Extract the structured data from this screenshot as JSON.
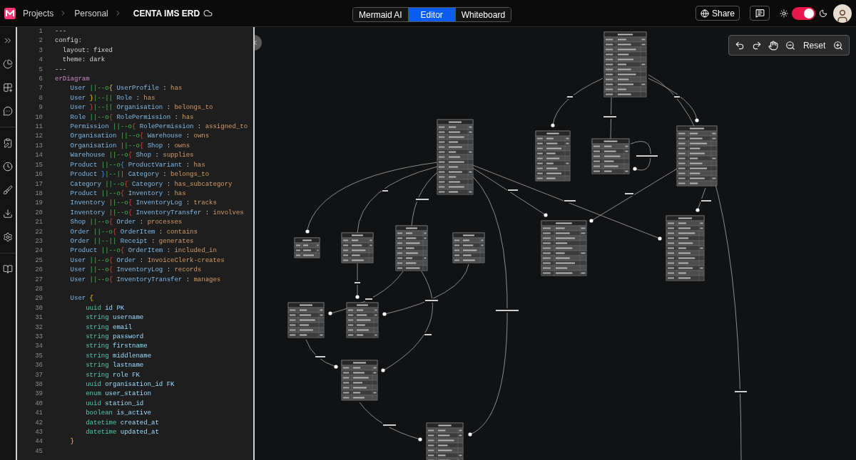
{
  "breadcrumbs": [
    {
      "label": "Projects"
    },
    {
      "label": "Personal"
    }
  ],
  "document_title": "CENTA IMS ERD",
  "tabs": [
    {
      "label": "Mermaid AI",
      "selected": false
    },
    {
      "label": "Editor",
      "selected": true
    },
    {
      "label": "Whiteboard",
      "selected": false
    }
  ],
  "share_button": "Share",
  "theme_toggle": {
    "on": true
  },
  "toolbar": {
    "reset_label": "Reset"
  },
  "editor": {
    "lines": [
      {
        "number": "1",
        "segments": [
          {
            "text": "---",
            "kind": "plain"
          }
        ]
      },
      {
        "number": "2",
        "segments": [
          {
            "text": "config:",
            "kind": "plain"
          }
        ]
      },
      {
        "number": "3",
        "segments": [
          {
            "text": "  layout: fixed",
            "kind": "plain"
          }
        ]
      },
      {
        "number": "4",
        "segments": [
          {
            "text": "  theme: dark",
            "kind": "plain"
          }
        ]
      },
      {
        "number": "5",
        "segments": [
          {
            "text": "---",
            "kind": "plain"
          }
        ]
      },
      {
        "number": "6",
        "segments": [
          {
            "text": "erDiagram",
            "kind": "keyword"
          }
        ]
      },
      {
        "number": "7",
        "segments": [
          {
            "text": "    User ",
            "kind": "entity"
          },
          {
            "text": "||--o",
            "kind": "relation"
          },
          {
            "text": "{",
            "kind": "bracket_gold"
          },
          {
            "text": " UserProfile ",
            "kind": "entity"
          },
          {
            "text": ": ",
            "kind": "punct"
          },
          {
            "text": "has",
            "kind": "label"
          }
        ]
      },
      {
        "number": "8",
        "segments": [
          {
            "text": "    User ",
            "kind": "entity"
          },
          {
            "text": "}",
            "kind": "bracket_gold"
          },
          {
            "text": "|--||",
            "kind": "relation"
          },
          {
            "text": " Role ",
            "kind": "entity"
          },
          {
            "text": ": ",
            "kind": "punct"
          },
          {
            "text": "has",
            "kind": "label"
          }
        ]
      },
      {
        "number": "9",
        "segments": [
          {
            "text": "    User ",
            "kind": "entity"
          },
          {
            "text": "}",
            "kind": "bracket_red"
          },
          {
            "text": "|--||",
            "kind": "relation"
          },
          {
            "text": " Organisation ",
            "kind": "entity"
          },
          {
            "text": ": ",
            "kind": "punct"
          },
          {
            "text": "belongs_to",
            "kind": "label"
          }
        ]
      },
      {
        "number": "10",
        "segments": [
          {
            "text": "    Role ",
            "kind": "entity"
          },
          {
            "text": "||--o",
            "kind": "relation"
          },
          {
            "text": "{",
            "kind": "bracket_red"
          },
          {
            "text": " RolePermission ",
            "kind": "entity"
          },
          {
            "text": ": ",
            "kind": "punct"
          },
          {
            "text": "has",
            "kind": "label"
          }
        ]
      },
      {
        "number": "11",
        "segments": [
          {
            "text": "    Permission ",
            "kind": "entity"
          },
          {
            "text": "||--o",
            "kind": "relation"
          },
          {
            "text": "{",
            "kind": "bracket_red"
          },
          {
            "text": " RolePermission ",
            "kind": "entity"
          },
          {
            "text": ": ",
            "kind": "punct"
          },
          {
            "text": "assigned_to",
            "kind": "label"
          }
        ]
      },
      {
        "number": "12",
        "segments": [
          {
            "text": "    Organisation ",
            "kind": "entity"
          },
          {
            "text": "||--o",
            "kind": "relation"
          },
          {
            "text": "{",
            "kind": "bracket_red"
          },
          {
            "text": " Warehouse ",
            "kind": "entity"
          },
          {
            "text": ": ",
            "kind": "punct"
          },
          {
            "text": "owns",
            "kind": "label"
          }
        ]
      },
      {
        "number": "13",
        "segments": [
          {
            "text": "    Organisation ",
            "kind": "entity"
          },
          {
            "text": "||--o",
            "kind": "relation"
          },
          {
            "text": "{",
            "kind": "bracket_red"
          },
          {
            "text": " Shop ",
            "kind": "entity"
          },
          {
            "text": ": ",
            "kind": "punct"
          },
          {
            "text": "owns",
            "kind": "label"
          }
        ]
      },
      {
        "number": "14",
        "segments": [
          {
            "text": "    Warehouse ",
            "kind": "entity"
          },
          {
            "text": "||--o",
            "kind": "relation"
          },
          {
            "text": "{",
            "kind": "bracket_red"
          },
          {
            "text": " Shop ",
            "kind": "entity"
          },
          {
            "text": ": ",
            "kind": "punct"
          },
          {
            "text": "supplies",
            "kind": "label"
          }
        ]
      },
      {
        "number": "15",
        "segments": [
          {
            "text": "    Product ",
            "kind": "entity"
          },
          {
            "text": "||--o",
            "kind": "relation"
          },
          {
            "text": "{",
            "kind": "bracket_blue"
          },
          {
            "text": " ProductVariant ",
            "kind": "entity"
          },
          {
            "text": ": ",
            "kind": "punct"
          },
          {
            "text": "has",
            "kind": "label"
          }
        ]
      },
      {
        "number": "16",
        "segments": [
          {
            "text": "    Product ",
            "kind": "entity"
          },
          {
            "text": "}",
            "kind": "bracket_blue"
          },
          {
            "text": "|--||",
            "kind": "relation"
          },
          {
            "text": " Category ",
            "kind": "entity"
          },
          {
            "text": ": ",
            "kind": "punct"
          },
          {
            "text": "belongs_to",
            "kind": "label"
          }
        ]
      },
      {
        "number": "17",
        "segments": [
          {
            "text": "    Category ",
            "kind": "entity"
          },
          {
            "text": "||--o",
            "kind": "relation"
          },
          {
            "text": "{",
            "kind": "bracket_red"
          },
          {
            "text": " Category ",
            "kind": "entity"
          },
          {
            "text": ": ",
            "kind": "punct"
          },
          {
            "text": "has_subcategory",
            "kind": "label"
          }
        ]
      },
      {
        "number": "18",
        "segments": [
          {
            "text": "    Product ",
            "kind": "entity"
          },
          {
            "text": "||--o",
            "kind": "relation"
          },
          {
            "text": "{",
            "kind": "bracket_red"
          },
          {
            "text": " Inventory ",
            "kind": "entity"
          },
          {
            "text": ": ",
            "kind": "punct"
          },
          {
            "text": "has",
            "kind": "label"
          }
        ]
      },
      {
        "number": "19",
        "segments": [
          {
            "text": "    Inventory ",
            "kind": "entity"
          },
          {
            "text": "||--o",
            "kind": "relation"
          },
          {
            "text": "{",
            "kind": "bracket_red"
          },
          {
            "text": " InventoryLog ",
            "kind": "entity"
          },
          {
            "text": ": ",
            "kind": "punct"
          },
          {
            "text": "tracks",
            "kind": "label"
          }
        ]
      },
      {
        "number": "20",
        "segments": [
          {
            "text": "    Inventory ",
            "kind": "entity"
          },
          {
            "text": "||--o",
            "kind": "relation"
          },
          {
            "text": "{",
            "kind": "bracket_red"
          },
          {
            "text": " InventoryTransfer ",
            "kind": "entity"
          },
          {
            "text": ": ",
            "kind": "punct"
          },
          {
            "text": "involves",
            "kind": "label"
          }
        ]
      },
      {
        "number": "21",
        "segments": [
          {
            "text": "    Shop ",
            "kind": "entity"
          },
          {
            "text": "||--o",
            "kind": "relation"
          },
          {
            "text": "{",
            "kind": "bracket_red"
          },
          {
            "text": " Order ",
            "kind": "entity"
          },
          {
            "text": ": ",
            "kind": "punct"
          },
          {
            "text": "processes",
            "kind": "label"
          }
        ]
      },
      {
        "number": "22",
        "segments": [
          {
            "text": "    Order ",
            "kind": "entity"
          },
          {
            "text": "||--o",
            "kind": "relation"
          },
          {
            "text": "{",
            "kind": "bracket_red"
          },
          {
            "text": " OrderItem ",
            "kind": "entity"
          },
          {
            "text": ": ",
            "kind": "punct"
          },
          {
            "text": "contains",
            "kind": "label"
          }
        ]
      },
      {
        "number": "23",
        "segments": [
          {
            "text": "    Order ",
            "kind": "entity"
          },
          {
            "text": "||--||",
            "kind": "relation"
          },
          {
            "text": " Receipt ",
            "kind": "entity"
          },
          {
            "text": ": ",
            "kind": "punct"
          },
          {
            "text": "generates",
            "kind": "label"
          }
        ]
      },
      {
        "number": "24",
        "segments": [
          {
            "text": "    Product ",
            "kind": "entity"
          },
          {
            "text": "||--o",
            "kind": "relation"
          },
          {
            "text": "{",
            "kind": "bracket_red"
          },
          {
            "text": " OrderItem ",
            "kind": "entity"
          },
          {
            "text": ": ",
            "kind": "punct"
          },
          {
            "text": "included_in",
            "kind": "label"
          }
        ]
      },
      {
        "number": "25",
        "segments": [
          {
            "text": "    User ",
            "kind": "entity"
          },
          {
            "text": "||--o",
            "kind": "relation"
          },
          {
            "text": "{",
            "kind": "bracket_red"
          },
          {
            "text": " Order ",
            "kind": "entity"
          },
          {
            "text": ": ",
            "kind": "punct"
          },
          {
            "text": "InvoiceClerk-creates",
            "kind": "label"
          }
        ]
      },
      {
        "number": "26",
        "segments": [
          {
            "text": "    User ",
            "kind": "entity"
          },
          {
            "text": "||--o",
            "kind": "relation"
          },
          {
            "text": "{",
            "kind": "bracket_red"
          },
          {
            "text": " InventoryLog ",
            "kind": "entity"
          },
          {
            "text": ": ",
            "kind": "punct"
          },
          {
            "text": "records",
            "kind": "label"
          }
        ]
      },
      {
        "number": "27",
        "segments": [
          {
            "text": "    User ",
            "kind": "entity"
          },
          {
            "text": "||--o",
            "kind": "relation"
          },
          {
            "text": "{",
            "kind": "bracket_red"
          },
          {
            "text": " InventoryTransfer ",
            "kind": "entity"
          },
          {
            "text": ": ",
            "kind": "punct"
          },
          {
            "text": "manages",
            "kind": "label"
          }
        ]
      },
      {
        "number": "28"
      },
      {
        "number": "29",
        "segments": [
          {
            "text": "    User ",
            "kind": "entity"
          },
          {
            "text": "{",
            "kind": "bracket_gold"
          }
        ]
      },
      {
        "number": "30",
        "segments": [
          {
            "text": "        uuid",
            "kind": "type"
          },
          {
            "text": " id",
            "kind": "field"
          },
          {
            "text": " PK",
            "kind": "key"
          }
        ]
      },
      {
        "number": "31",
        "segments": [
          {
            "text": "        string",
            "kind": "type"
          },
          {
            "text": " username",
            "kind": "field"
          }
        ]
      },
      {
        "number": "32",
        "segments": [
          {
            "text": "        string",
            "kind": "type"
          },
          {
            "text": " email",
            "kind": "field"
          }
        ]
      },
      {
        "number": "33",
        "segments": [
          {
            "text": "        string",
            "kind": "type"
          },
          {
            "text": " password",
            "kind": "field"
          }
        ]
      },
      {
        "number": "34",
        "segments": [
          {
            "text": "        string",
            "kind": "type"
          },
          {
            "text": " firstname",
            "kind": "field"
          }
        ]
      },
      {
        "number": "35",
        "segments": [
          {
            "text": "        string",
            "kind": "type"
          },
          {
            "text": " middlename",
            "kind": "field"
          }
        ]
      },
      {
        "number": "36",
        "segments": [
          {
            "text": "        string",
            "kind": "type"
          },
          {
            "text": " lastname",
            "kind": "field"
          }
        ]
      },
      {
        "number": "37",
        "segments": [
          {
            "text": "        string",
            "kind": "type"
          },
          {
            "text": " role",
            "kind": "field"
          },
          {
            "text": " FK",
            "kind": "key"
          }
        ]
      },
      {
        "number": "38",
        "segments": [
          {
            "text": "        uuid",
            "kind": "type"
          },
          {
            "text": " organisation_id",
            "kind": "field"
          },
          {
            "text": " FK",
            "kind": "key"
          }
        ]
      },
      {
        "number": "39",
        "segments": [
          {
            "text": "        enum",
            "kind": "type"
          },
          {
            "text": " user_station",
            "kind": "field"
          }
        ]
      },
      {
        "number": "40",
        "segments": [
          {
            "text": "        uuid",
            "kind": "type"
          },
          {
            "text": " station_id",
            "kind": "field"
          }
        ]
      },
      {
        "number": "41",
        "segments": [
          {
            "text": "        boolean",
            "kind": "type"
          },
          {
            "text": " is_active",
            "kind": "field"
          }
        ]
      },
      {
        "number": "42",
        "segments": [
          {
            "text": "        datetime",
            "kind": "type"
          },
          {
            "text": " created_at",
            "kind": "field"
          }
        ]
      },
      {
        "number": "43",
        "segments": [
          {
            "text": "        datetime",
            "kind": "type"
          },
          {
            "text": " updated_at",
            "kind": "field"
          }
        ]
      },
      {
        "number": "44",
        "segments": [
          {
            "text": "    }",
            "kind": "bracket_gold"
          }
        ]
      },
      {
        "number": "45"
      }
    ]
  }
}
